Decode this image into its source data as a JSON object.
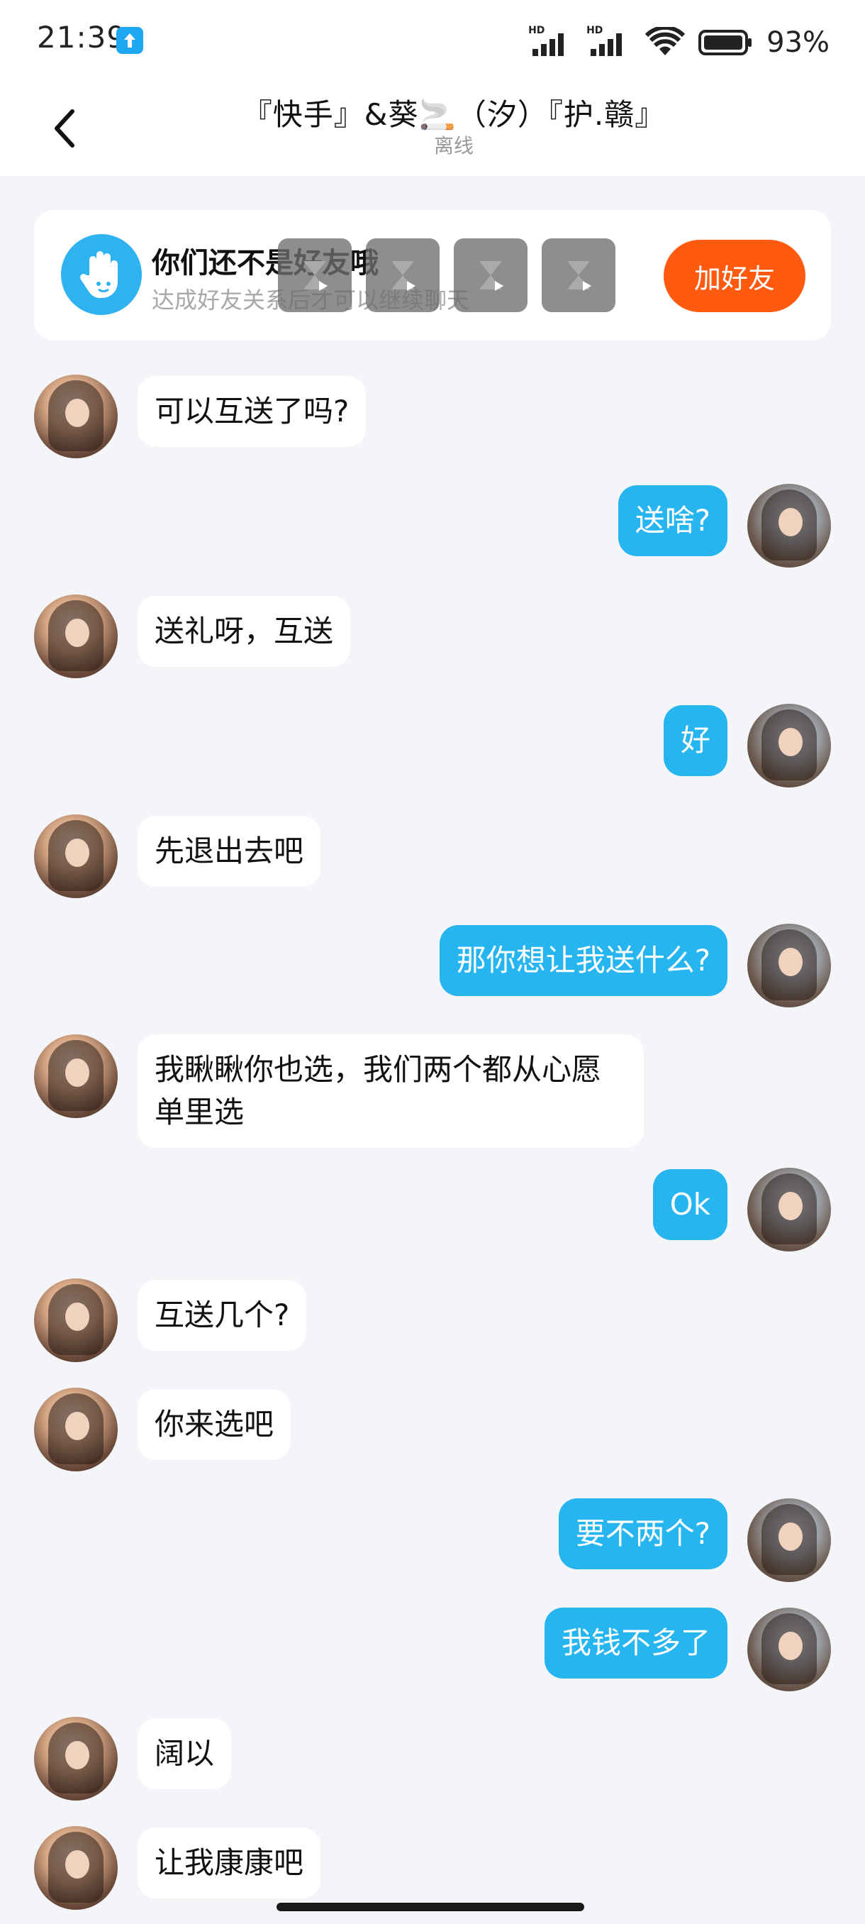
{
  "status": {
    "time": "21:39",
    "battery": "93%",
    "hd1": "HD",
    "hd2": "HD"
  },
  "header": {
    "title": "『快手』&葵🚬（汐）『护.赣』",
    "status": "离线"
  },
  "notice": {
    "title": "你们还不是好友哦",
    "subtitle": "达成好友关系后才可以继续聊天",
    "add_button": "加好友"
  },
  "messages": [
    {
      "side": "in",
      "text": "可以互送了吗?"
    },
    {
      "side": "out",
      "text": "送啥?"
    },
    {
      "side": "in",
      "text": "送礼呀，互送"
    },
    {
      "side": "out",
      "text": "好"
    },
    {
      "side": "in",
      "text": "先退出去吧"
    },
    {
      "side": "out",
      "text": "那你想让我送什么?"
    },
    {
      "side": "in",
      "text": "我瞅瞅你也选，我们两个都从心愿单里选"
    },
    {
      "side": "out",
      "text": "Ok"
    },
    {
      "side": "in",
      "text": "互送几个?"
    },
    {
      "side": "in",
      "text": "你来选吧"
    },
    {
      "side": "out",
      "text": "要不两个?"
    },
    {
      "side": "out",
      "text": "我钱不多了"
    },
    {
      "side": "in",
      "text": "阔以"
    },
    {
      "side": "in",
      "text": "让我康康吧"
    }
  ],
  "icons": {
    "back": "chevron-left-icon",
    "wave": "hand-wave-icon",
    "upload": "upload-arrow-icon",
    "wifi": "wifi-icon",
    "battery": "battery-icon"
  },
  "colors": {
    "outgoing_bubble": "#27b5f0",
    "incoming_bubble": "#ffffff",
    "add_button": "#ff5a0f",
    "background": "#f3f5f9"
  }
}
